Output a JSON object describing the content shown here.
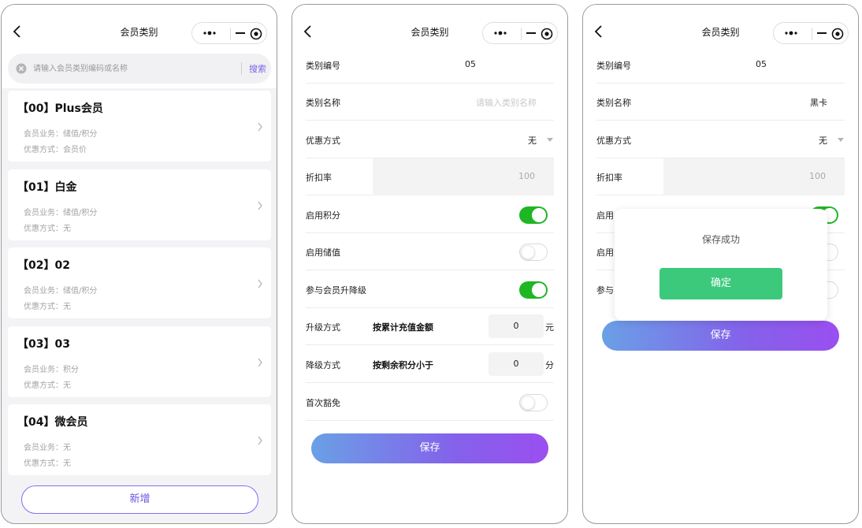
{
  "screens": [
    {
      "nav_title": "会员类别",
      "search": {
        "placeholder": "请输入会员类别编码或名称",
        "button": "搜索"
      },
      "categories": [
        {
          "title": "【00】Plus会员",
          "business": "会员业务：储值/积分",
          "discount": "优惠方式：会员价"
        },
        {
          "title": "【01】白金",
          "business": "会员业务：储值/积分",
          "discount": "优惠方式：无"
        },
        {
          "title": "【02】02",
          "business": "会员业务：储值/积分",
          "discount": "优惠方式：无"
        },
        {
          "title": "【03】03",
          "business": "会员业务：积分",
          "discount": "优惠方式：无"
        },
        {
          "title": "【04】微会员",
          "business": "会员业务：无",
          "discount": "优惠方式：无"
        }
      ],
      "add_button": "新增"
    },
    {
      "nav_title": "会员类别",
      "form": {
        "code_label": "类别编号",
        "code_value": "05",
        "name_label": "类别名称",
        "name_placeholder": "请输入类别名称",
        "discount_mode_label": "优惠方式",
        "discount_mode_value": "无",
        "discount_rate_label": "折扣率",
        "discount_rate_value": "100",
        "points_label": "启用积分",
        "points_on": true,
        "stored_label": "启用储值",
        "stored_on": false,
        "upgrade_label": "参与会员升降级",
        "upgrade_on": true,
        "up_mode_label": "升级方式",
        "up_mode_text": "按累计充值金额",
        "up_mode_value": "0",
        "up_mode_unit": "元",
        "down_mode_label": "降级方式",
        "down_mode_text": "按剩余积分小于",
        "down_mode_value": "0",
        "down_mode_unit": "分",
        "first_free_label": "首次豁免",
        "first_free_on": false
      },
      "save_button": "保存"
    },
    {
      "nav_title": "会员类别",
      "form": {
        "code_label": "类别编号",
        "code_value": "05",
        "name_label": "类别名称",
        "name_value": "黑卡",
        "discount_mode_label": "优惠方式",
        "discount_mode_value": "无",
        "discount_rate_label": "折扣率",
        "discount_rate_value": "100",
        "points_label_partial": "启用",
        "stored_label_partial": "启用",
        "upgrade_label_partial": "参与"
      },
      "save_button": "保存",
      "modal": {
        "message": "保存成功",
        "confirm": "确定"
      }
    }
  ],
  "colors": {
    "accent": "#7b63e6",
    "toggle_on": "#1fb624",
    "confirm_green": "#3cc97c"
  }
}
